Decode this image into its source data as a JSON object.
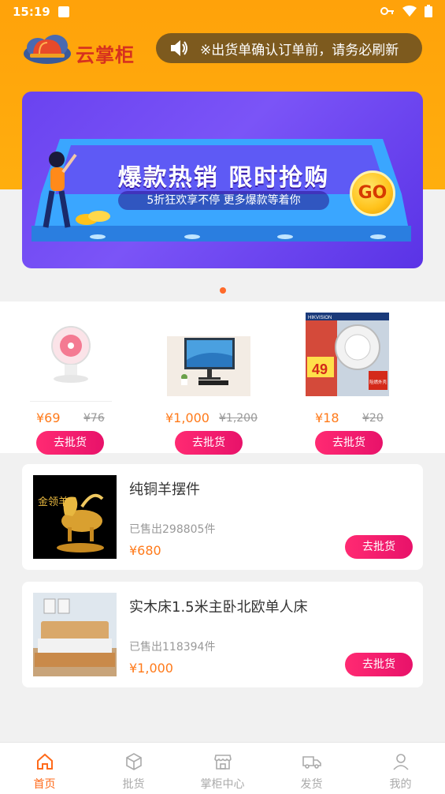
{
  "status_bar": {
    "time": "15:19"
  },
  "header": {
    "app_name": "云掌柜",
    "notice": "※出货单确认订单前，请务必刷新"
  },
  "banner": {
    "title": "爆款热销 限时抢购",
    "subtitle": "5折狂欢享不停 更多爆款等着你",
    "go_label": "GO",
    "page_count": 1,
    "active_page": 1
  },
  "featured_products": [
    {
      "price": "¥69",
      "original_price": "¥76",
      "button": "去批货",
      "image": "pink-desk-fan"
    },
    {
      "price": "¥1,000",
      "original_price": "¥1,200",
      "button": "去批货",
      "image": "desktop-monitor"
    },
    {
      "price": "¥18",
      "original_price": "¥20",
      "button": "去批货",
      "image": "smoke-detector-ad"
    }
  ],
  "smoke_ad": {
    "brand": "HIKVISION",
    "badge": "49",
    "tag": "阻燃外壳"
  },
  "list_products": [
    {
      "title": "纯铜羊摆件",
      "sold": "已售出298805件",
      "price": "¥680",
      "button": "去批货",
      "image": "golden-goat-ornament",
      "image_text": "金领羊"
    },
    {
      "title": "实木床1.5米主卧北欧单人床",
      "sold": "已售出118394件",
      "price": "¥1,000",
      "button": "去批货",
      "image": "wooden-bed"
    }
  ],
  "tabbar": [
    {
      "label": "首页",
      "icon": "home-icon",
      "active": true
    },
    {
      "label": "批货",
      "icon": "box-icon",
      "active": false
    },
    {
      "label": "掌柜中心",
      "icon": "store-icon",
      "active": false
    },
    {
      "label": "发货",
      "icon": "truck-icon",
      "active": false
    },
    {
      "label": "我的",
      "icon": "user-icon",
      "active": false
    }
  ],
  "colors": {
    "header_orange": "#ffa20a",
    "price_orange": "#ff7a1a",
    "button_pink": "#e8126a",
    "brand_red": "#d6311f",
    "tab_active": "#ff6a1a"
  }
}
